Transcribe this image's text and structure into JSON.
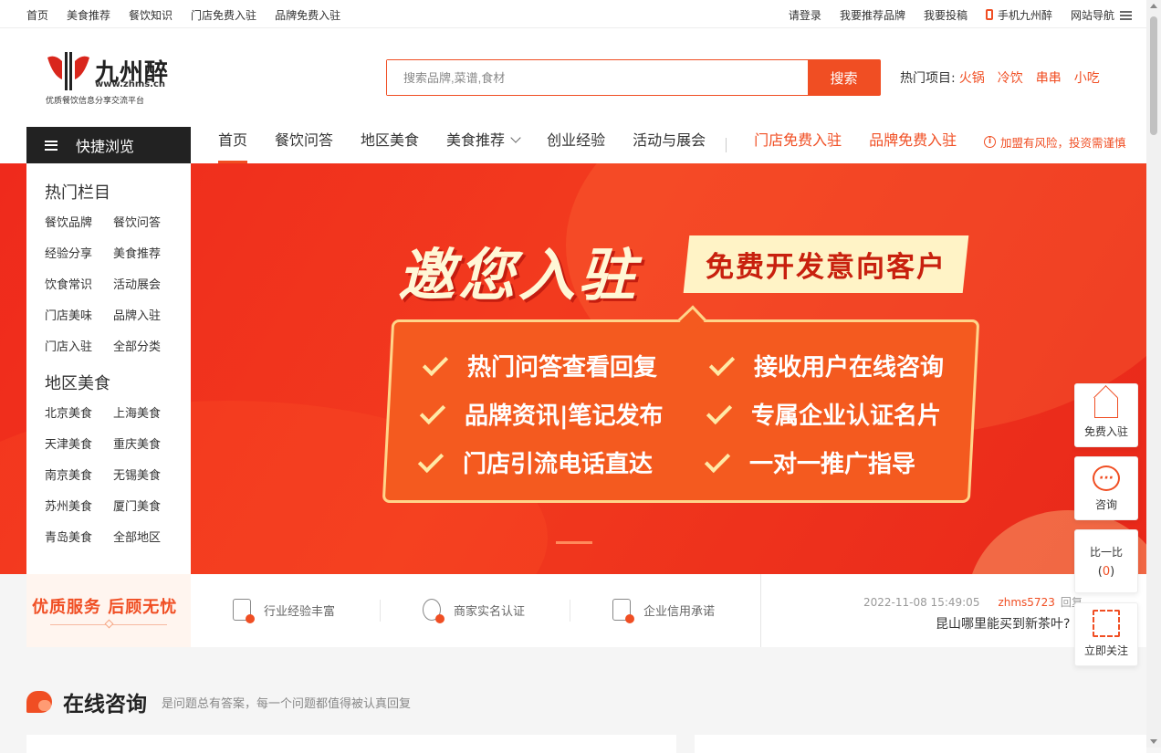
{
  "topbar": {
    "left": [
      "首页",
      "美食推荐",
      "餐饮知识",
      "门店免费入驻",
      "品牌免费入驻"
    ],
    "login": "请登录",
    "recommend": "我要推荐品牌",
    "submit": "我要投稿",
    "mobile": "手机九州醉",
    "sitenav": "网站导航"
  },
  "logo": {
    "name": "九州醉",
    "url": "www.zhms.cn",
    "slogan": "优质餐饮信息分享交流平台"
  },
  "search": {
    "placeholder": "搜索品牌,菜谱,食材",
    "button": "搜索"
  },
  "hot": {
    "label": "热门项目:",
    "items": [
      "火锅",
      "冷饮",
      "串串",
      "小吃"
    ]
  },
  "quick": {
    "label": "快捷浏览"
  },
  "nav": {
    "items": [
      "首页",
      "餐饮问答",
      "地区美食",
      "美食推荐",
      "创业经验",
      "活动与展会"
    ],
    "store": "门店免费入驻",
    "brand": "品牌免费入驻",
    "warning": "加盟有风险，投资需谨慎"
  },
  "sidebar": {
    "hot_title": "热门栏目",
    "hot_items": [
      "餐饮品牌",
      "餐饮问答",
      "经验分享",
      "美食推荐",
      "饮食常识",
      "活动展会",
      "门店美味",
      "品牌入驻",
      "门店入驻",
      "全部分类"
    ],
    "region_title": "地区美食",
    "region_items": [
      "北京美食",
      "上海美食",
      "天津美食",
      "重庆美食",
      "南京美食",
      "无锡美食",
      "苏州美食",
      "厦门美食",
      "青岛美食",
      "全部地区"
    ]
  },
  "banner": {
    "title": "邀您入驻",
    "tag": "免费开发意向客户",
    "features": [
      "热门问答查看回复",
      "接收用户在线咨询",
      "品牌资讯|笔记发布",
      "专属企业认证名片",
      "门店引流电话直达",
      "一对一推广指导"
    ]
  },
  "stats": {
    "service": "优质服务 后顾无忧",
    "items": [
      "行业经验丰富",
      "商家实名认证",
      "企业信用承诺"
    ]
  },
  "news": {
    "time": "2022-11-08 15:49:05",
    "user": "zhms5723",
    "reply": "回复",
    "question": "昆山哪里能买到新茶叶?"
  },
  "section": {
    "title": "在线咨询",
    "subtitle": "是问题总有答案，每一个问题都值得被认真回复"
  },
  "float": {
    "join": "免费入驻",
    "consult": "咨询",
    "compare": "比一比",
    "compare_count": "0",
    "follow": "立即关注"
  }
}
